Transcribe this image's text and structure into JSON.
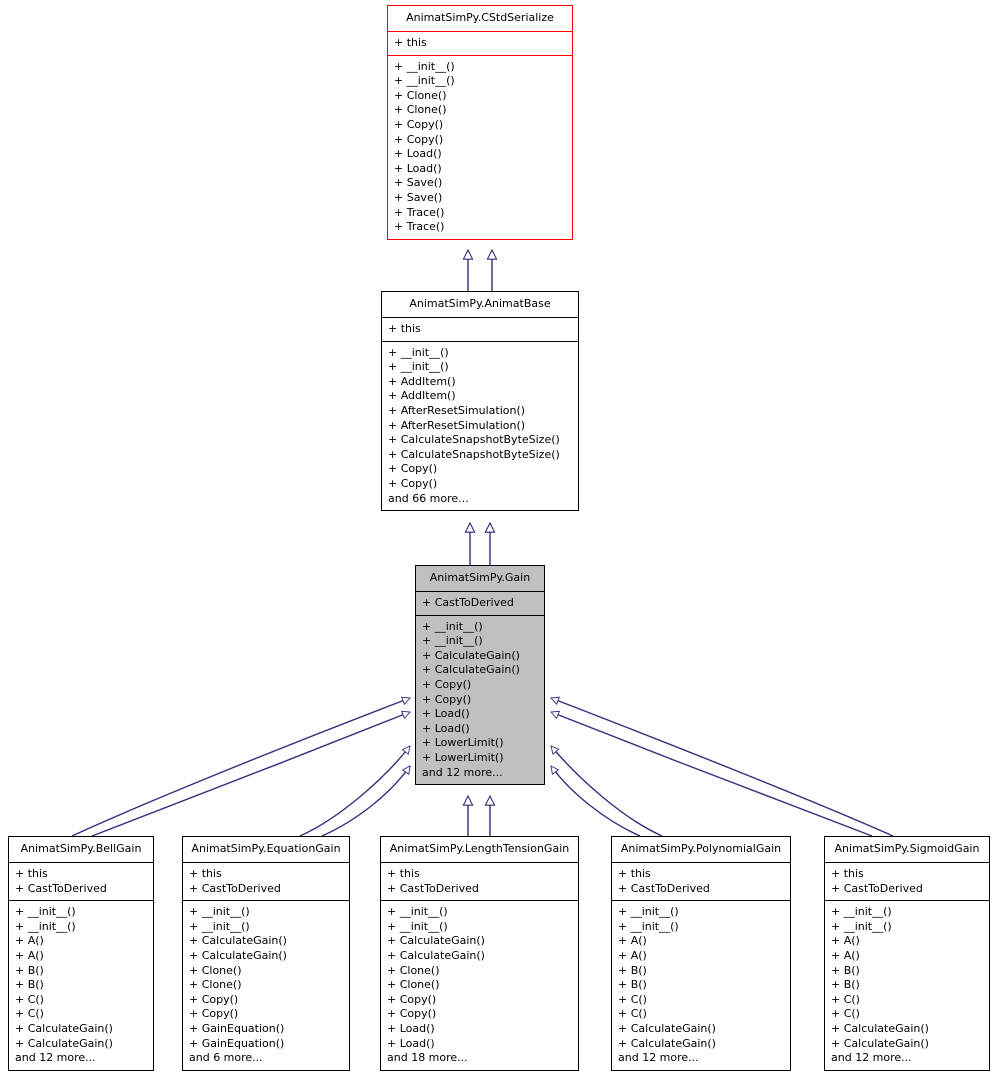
{
  "diagram": {
    "kind": "uml-class-inheritance-diagram",
    "title": "AnimatSimPy.Gain inheritance diagram",
    "colors": {
      "base_border": "#ff0000",
      "node_border": "#000000",
      "highlight_fill": "#c0c0c0",
      "node_fill": "#ffffff",
      "edge": "#2f2f7f",
      "text": "#000000"
    },
    "edge_style": "hollow-triangle-inheritance-arrow"
  },
  "nodes": [
    {
      "id": "cstdserialize",
      "title": "AnimatSimPy.CStdSerialize",
      "style": "red",
      "attributes": [
        "+ this"
      ],
      "methods": [
        "+ __init__()",
        "+ __init__()",
        "+ Clone()",
        "+ Clone()",
        "+ Copy()",
        "+ Copy()",
        "+ Load()",
        "+ Load()",
        "+ Save()",
        "+ Save()",
        "+ Trace()",
        "+ Trace()"
      ]
    },
    {
      "id": "animatbase",
      "title": "AnimatSimPy.AnimatBase",
      "style": "plain",
      "attributes": [
        "+ this"
      ],
      "methods": [
        "+ __init__()",
        "+ __init__()",
        "+ AddItem()",
        "+ AddItem()",
        "+ AfterResetSimulation()",
        "+ AfterResetSimulation()",
        "+ CalculateSnapshotByteSize()",
        "+ CalculateSnapshotByteSize()",
        "+ Copy()",
        "+ Copy()",
        "and 66 more..."
      ]
    },
    {
      "id": "gain",
      "title": "AnimatSimPy.Gain",
      "style": "highlight",
      "attributes": [
        "+ CastToDerived"
      ],
      "methods": [
        "+ __init__()",
        "+ __init__()",
        "+ CalculateGain()",
        "+ CalculateGain()",
        "+ Copy()",
        "+ Copy()",
        "+ Load()",
        "+ Load()",
        "+ LowerLimit()",
        "+ LowerLimit()",
        "and 12 more..."
      ]
    },
    {
      "id": "bellgain",
      "title": "AnimatSimPy.BellGain",
      "style": "plain",
      "attributes": [
        "+ this",
        "+ CastToDerived"
      ],
      "methods": [
        "+ __init__()",
        "+ __init__()",
        "+ A()",
        "+ A()",
        "+ B()",
        "+ B()",
        "+ C()",
        "+ C()",
        "+ CalculateGain()",
        "+ CalculateGain()",
        "and 12 more..."
      ]
    },
    {
      "id": "equationgain",
      "title": "AnimatSimPy.EquationGain",
      "style": "plain",
      "attributes": [
        "+ this",
        "+ CastToDerived"
      ],
      "methods": [
        "+ __init__()",
        "+ __init__()",
        "+ CalculateGain()",
        "+ CalculateGain()",
        "+ Clone()",
        "+ Clone()",
        "+ Copy()",
        "+ Copy()",
        "+ GainEquation()",
        "+ GainEquation()",
        "and 6 more..."
      ]
    },
    {
      "id": "lengthtensiongain",
      "title": "AnimatSimPy.LengthTensionGain",
      "style": "plain",
      "attributes": [
        "+ this",
        "+ CastToDerived"
      ],
      "methods": [
        "+ __init__()",
        "+ __init__()",
        "+ CalculateGain()",
        "+ CalculateGain()",
        "+ Clone()",
        "+ Clone()",
        "+ Copy()",
        "+ Copy()",
        "+ Load()",
        "+ Load()",
        "and 18 more..."
      ]
    },
    {
      "id": "polynomialgain",
      "title": "AnimatSimPy.PolynomialGain",
      "style": "plain",
      "attributes": [
        "+ this",
        "+ CastToDerived"
      ],
      "methods": [
        "+ __init__()",
        "+ __init__()",
        "+ A()",
        "+ A()",
        "+ B()",
        "+ B()",
        "+ C()",
        "+ C()",
        "+ CalculateGain()",
        "+ CalculateGain()",
        "and 12 more..."
      ]
    },
    {
      "id": "sigmoidgain",
      "title": "AnimatSimPy.SigmoidGain",
      "style": "plain",
      "attributes": [
        "+ this",
        "+ CastToDerived"
      ],
      "methods": [
        "+ __init__()",
        "+ __init__()",
        "+ A()",
        "+ A()",
        "+ B()",
        "+ B()",
        "+ C()",
        "+ C()",
        "+ CalculateGain()",
        "+ CalculateGain()",
        "and 12 more..."
      ]
    }
  ],
  "edges": [
    {
      "from": "animatbase",
      "to": "cstdserialize"
    },
    {
      "from": "animatbase",
      "to": "cstdserialize"
    },
    {
      "from": "gain",
      "to": "animatbase"
    },
    {
      "from": "gain",
      "to": "animatbase"
    },
    {
      "from": "bellgain",
      "to": "gain"
    },
    {
      "from": "bellgain",
      "to": "gain"
    },
    {
      "from": "equationgain",
      "to": "gain"
    },
    {
      "from": "equationgain",
      "to": "gain"
    },
    {
      "from": "lengthtensiongain",
      "to": "gain"
    },
    {
      "from": "lengthtensiongain",
      "to": "gain"
    },
    {
      "from": "polynomialgain",
      "to": "gain"
    },
    {
      "from": "polynomialgain",
      "to": "gain"
    },
    {
      "from": "sigmoidgain",
      "to": "gain"
    },
    {
      "from": "sigmoidgain",
      "to": "gain"
    }
  ]
}
